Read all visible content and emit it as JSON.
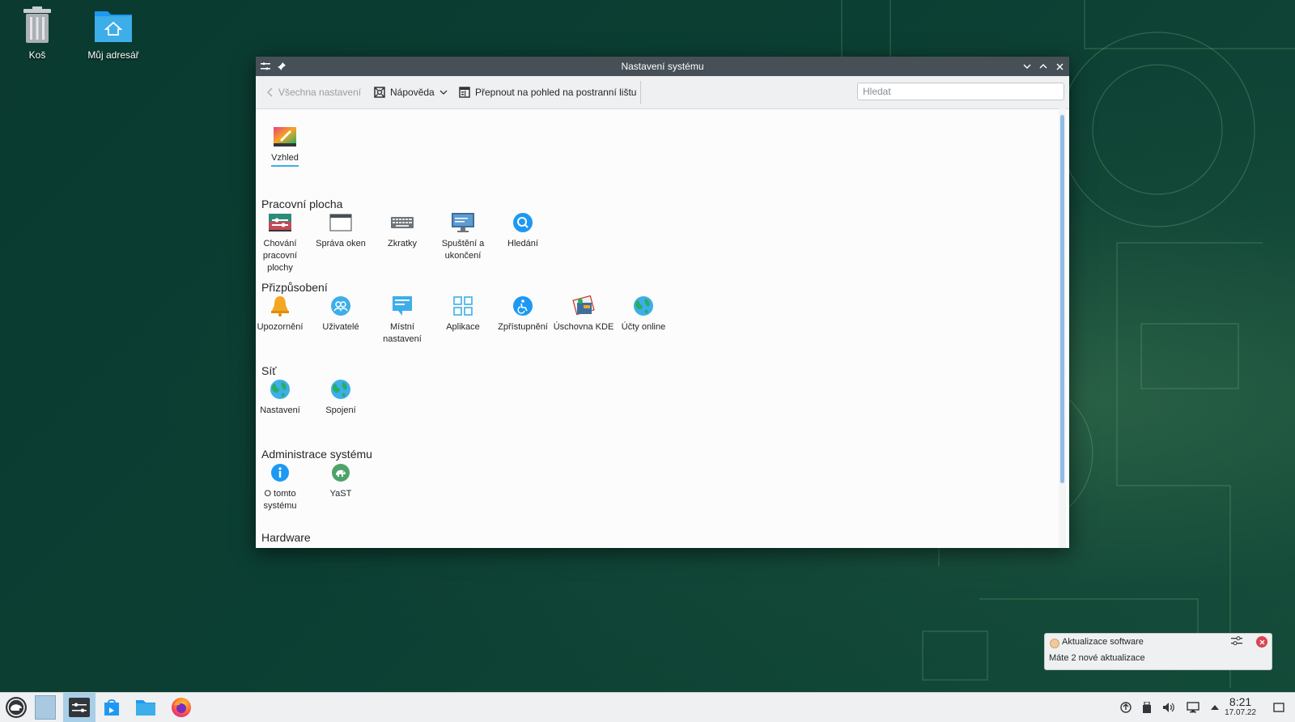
{
  "desktop": {
    "icons": [
      {
        "label": "Koš",
        "icon": "trash-icon"
      },
      {
        "label": "Můj adresář",
        "icon": "home-folder-icon"
      }
    ]
  },
  "window": {
    "title": "Nastavení systému",
    "toolbar": {
      "back_label": "Všechna nastavení",
      "help_label": "Nápověda",
      "sidebar_label": "Přepnout na pohled na postranní lištu",
      "search_placeholder": "Hledat"
    },
    "top_item": {
      "label": "Vzhled",
      "icon": "appearance-icon"
    },
    "sections": [
      {
        "title": "Pracovní plocha",
        "items": [
          {
            "label": "Chování pracovní plochy",
            "icon": "desktop-behavior-icon"
          },
          {
            "label": "Správa oken",
            "icon": "window-management-icon"
          },
          {
            "label": "Zkratky",
            "icon": "keyboard-icon"
          },
          {
            "label": "Spuštění a ukončení",
            "icon": "startup-shutdown-icon"
          },
          {
            "label": "Hledání",
            "icon": "search-icon"
          }
        ]
      },
      {
        "title": "Přizpůsobení",
        "items": [
          {
            "label": "Upozornění",
            "icon": "bell-icon"
          },
          {
            "label": "Uživatelé",
            "icon": "users-icon"
          },
          {
            "label": "Místní nastavení",
            "icon": "regional-settings-icon"
          },
          {
            "label": "Aplikace",
            "icon": "applications-icon"
          },
          {
            "label": "Zpřístupnění",
            "icon": "accessibility-icon"
          },
          {
            "label": "Úschovna KDE",
            "icon": "kde-wallet-icon"
          },
          {
            "label": "Účty online",
            "icon": "globe-icon"
          }
        ]
      },
      {
        "title": "Síť",
        "items": [
          {
            "label": "Nastavení",
            "icon": "globe-icon"
          },
          {
            "label": "Spojení",
            "icon": "globe-icon"
          }
        ]
      },
      {
        "title": "Administrace systému",
        "items": [
          {
            "label": "O tomto systému",
            "icon": "info-icon"
          },
          {
            "label": "YaST",
            "icon": "yast-chameleon-icon"
          }
        ]
      },
      {
        "title": "Hardware",
        "items": []
      }
    ]
  },
  "notification": {
    "title": "Aktualizace software",
    "body": "Máte 2 nové aktualizace"
  },
  "taskbar": {
    "clock_time": "8:21",
    "clock_date": "17.07.22"
  },
  "colors": {
    "accent": "#3daee9",
    "titlebar": "#475057",
    "wallpaper": "#0c3f33"
  }
}
